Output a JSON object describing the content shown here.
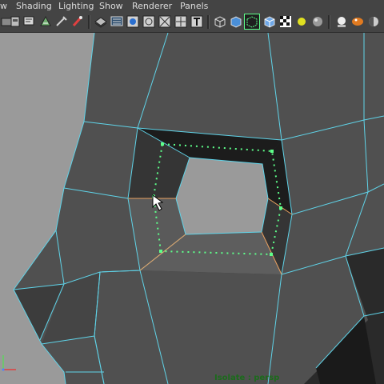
{
  "menu": [
    "w",
    "Shading",
    "Lighting",
    "Show",
    "Renderer",
    "Panels"
  ],
  "toolbar": {
    "icons": [
      "camera-select-icon",
      "camera-lock-icon",
      "camera-attributes-icon",
      "bookmark-icon",
      "image-plane-icon",
      "grid-icon",
      "film-gate-icon",
      "resolution-gate-icon",
      "gate-mask-icon",
      "safe-title-icon",
      "wireframe-icon",
      "smooth-shade-icon",
      "wireframe-on-shaded-icon",
      "textured-icon",
      "lights-icon",
      "shadows-icon",
      "high-quality-icon",
      "isolate-select-icon",
      "xray-icon"
    ]
  },
  "viewport": {
    "mesh_color": "#505050",
    "wire_color": "#5fd3e8",
    "hole_color": "#9a9a9a",
    "selection_color": "#5eff8a",
    "edge_highlight_color": "#e8a060",
    "dark_face_color": "#1c1c1c"
  },
  "status": {
    "isolate_label": "Isolate : persp"
  }
}
